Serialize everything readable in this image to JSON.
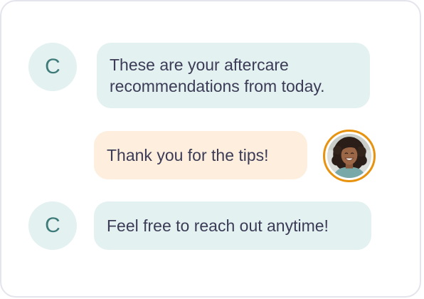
{
  "messages": [
    {
      "sender": "agent",
      "avatar_letter": "C",
      "text_lines": [
        "These are your aftercare",
        "recommendations from today."
      ]
    },
    {
      "sender": "user",
      "avatar": "user-photo-avatar",
      "text": "Thank you for the tips!"
    },
    {
      "sender": "agent",
      "avatar_letter": "C",
      "text": "Feel free to reach out anytime!"
    }
  ],
  "colors": {
    "agent_bubble": "#e3f1f1",
    "agent_avatar_text": "#3f7b79",
    "user_bubble": "#fdeedd",
    "user_avatar_ring": "#e8930f",
    "text": "#3c3c57",
    "card_border": "#e4e4ec"
  }
}
